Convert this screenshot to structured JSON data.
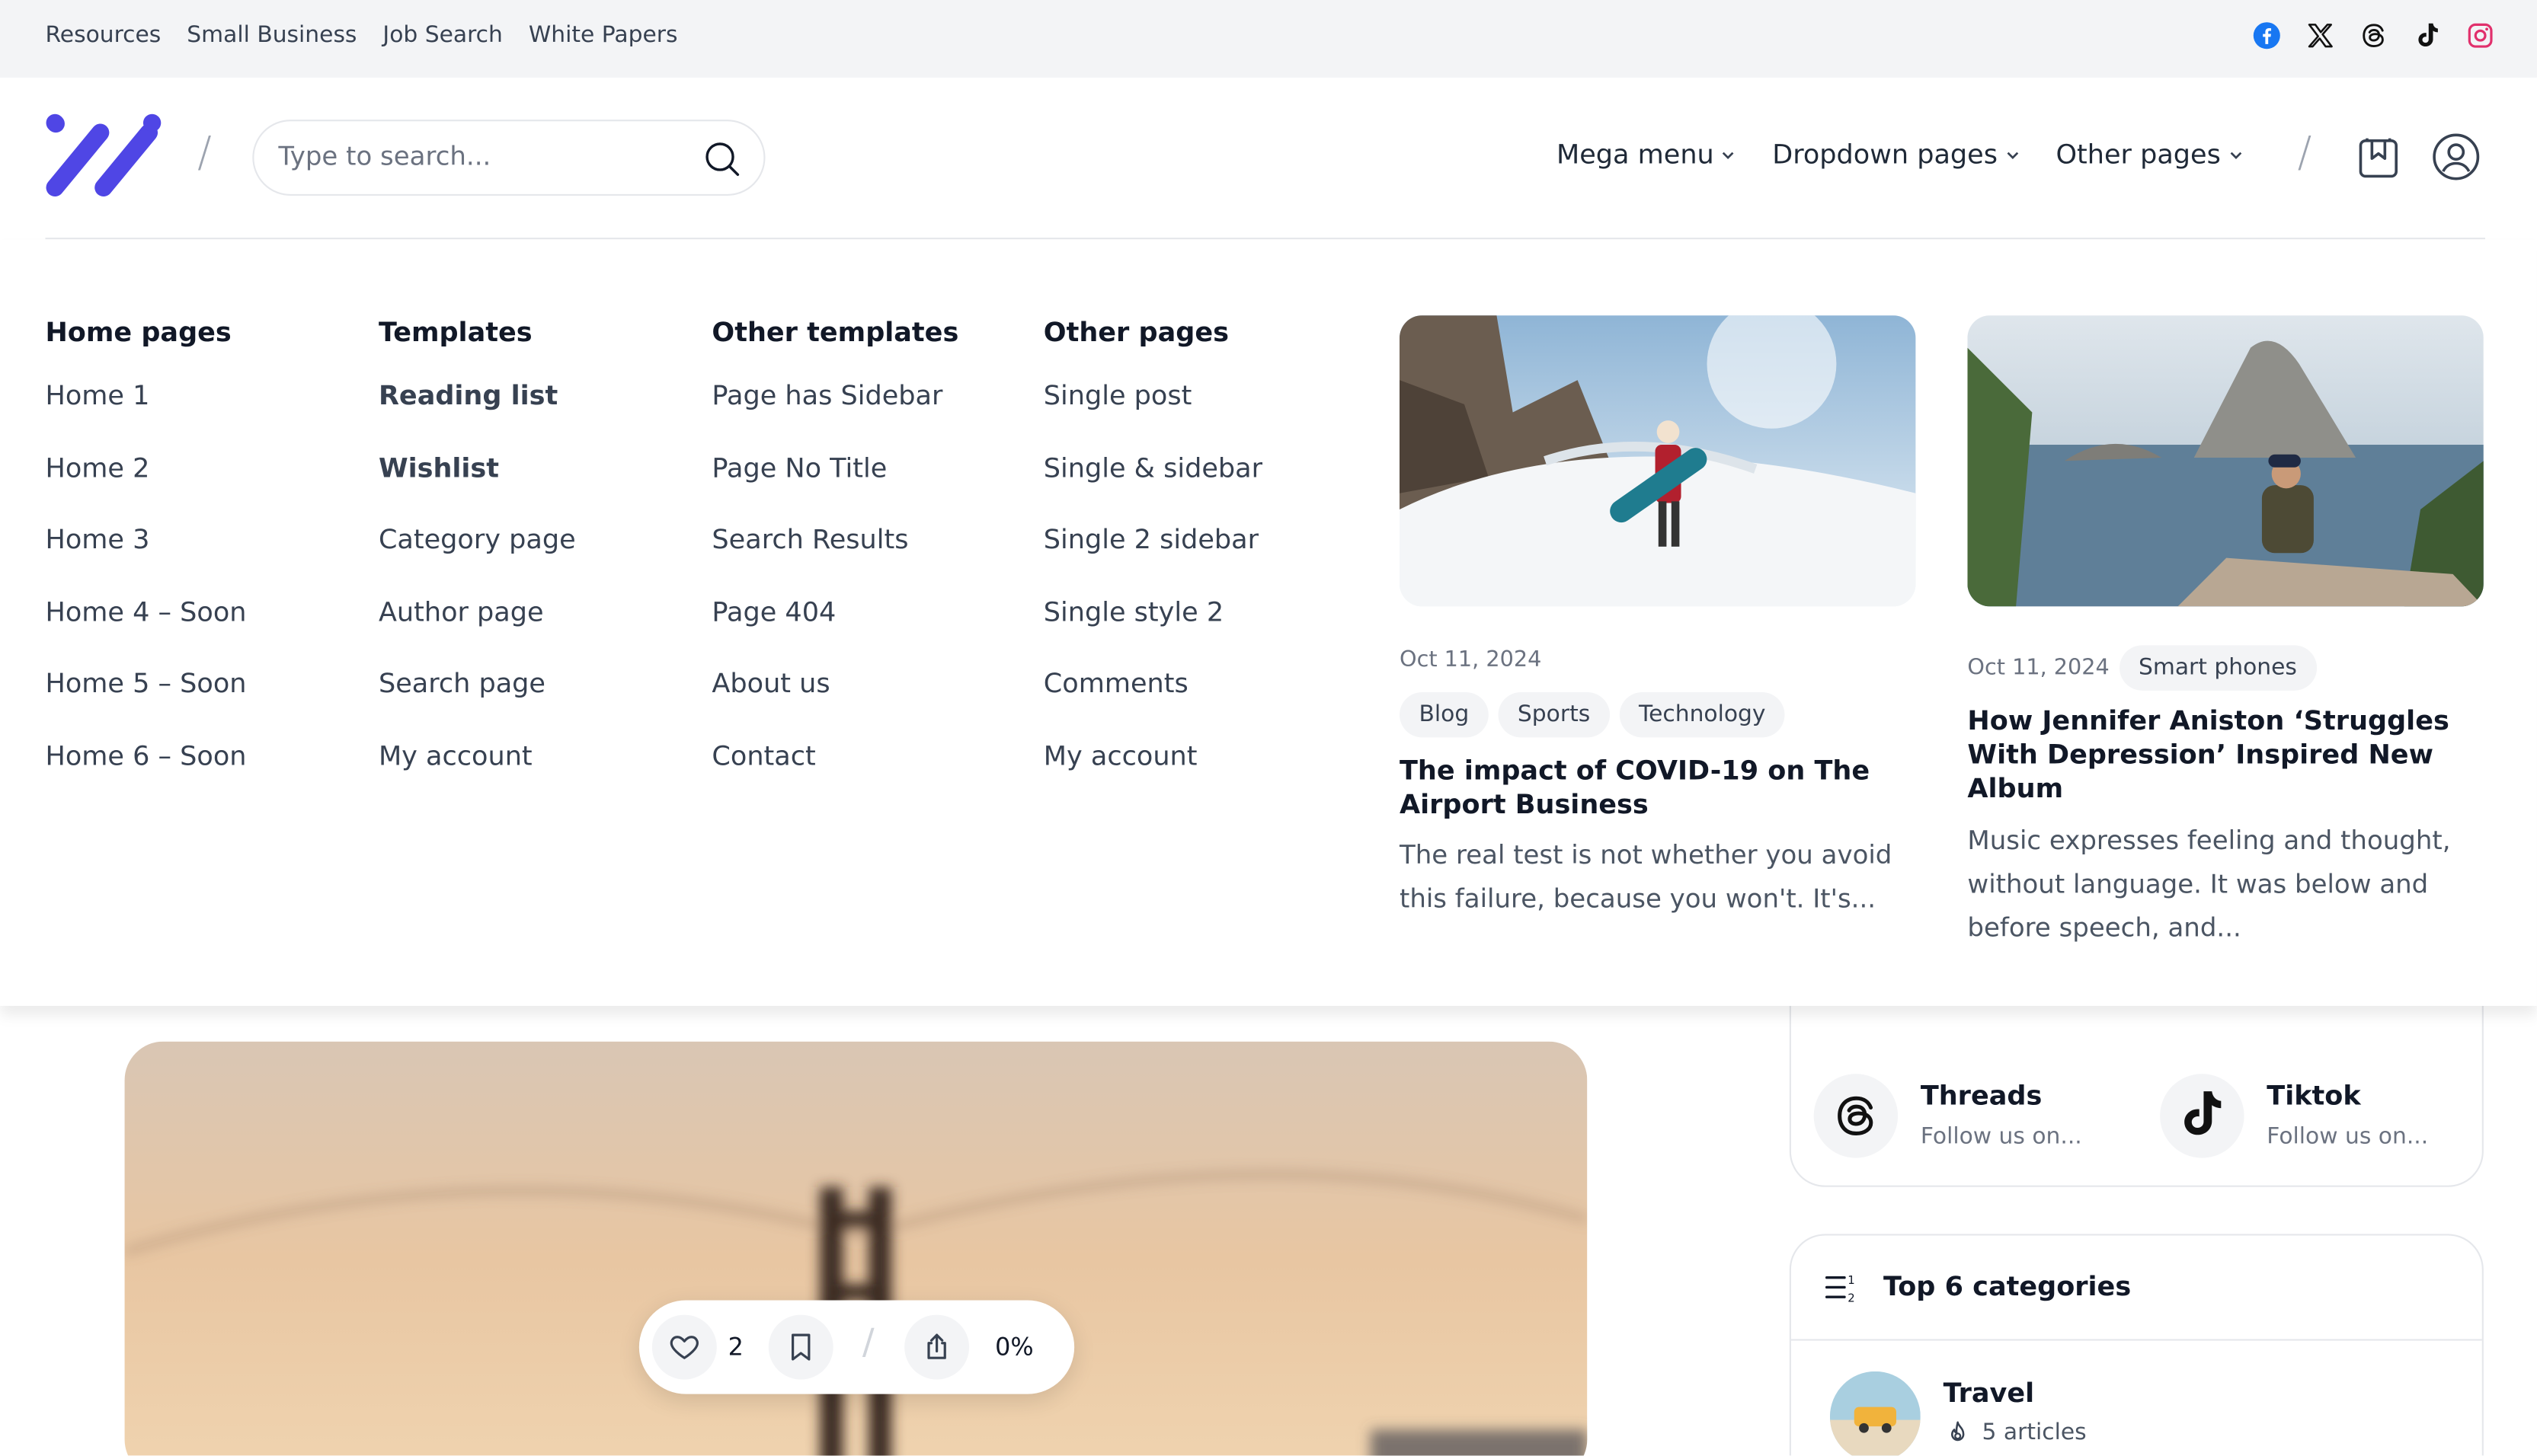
{
  "topbar": {
    "links": [
      "Resources",
      "Small Business",
      "Job Search",
      "White Papers"
    ],
    "social_icons": [
      "facebook-icon",
      "x-icon",
      "threads-icon",
      "tiktok-icon",
      "instagram-icon"
    ]
  },
  "colors": {
    "brand": "#4f46e5",
    "facebook": "#1877f2",
    "instagram": "#e1306c"
  },
  "header": {
    "search_placeholder": "Type to search...",
    "nav": [
      {
        "label": "Mega menu"
      },
      {
        "label": "Dropdown pages"
      },
      {
        "label": "Other pages"
      }
    ]
  },
  "mega_menu": {
    "columns": [
      {
        "title": "Home pages",
        "links": [
          "Home 1",
          "Home 2",
          "Home 3",
          "Home 4 – Soon",
          "Home 5 – Soon",
          "Home 6 – Soon"
        ]
      },
      {
        "title": "Templates",
        "links": [
          "Reading list",
          "Wishlist",
          "Category page",
          "Author page",
          "Search page",
          "My account"
        ]
      },
      {
        "title": "Other templates",
        "links": [
          "Page has Sidebar",
          "Page No Title",
          "Search Results",
          "Page 404",
          "About us",
          "Contact"
        ]
      },
      {
        "title": "Other pages",
        "links": [
          "Single post",
          "Single & sidebar",
          "Single 2 sidebar",
          "Single style 2",
          "Comments",
          "My account"
        ]
      }
    ],
    "posts": [
      {
        "date": "Oct 11, 2024",
        "tags": [
          "Blog",
          "Sports",
          "Technology"
        ],
        "title": "The impact of COVID-19 on The Airport Business",
        "excerpt": "The real test is not whether you avoid this failure, because you won't. It's..."
      },
      {
        "date": "Oct 11, 2024",
        "tags": [
          "Smart phones"
        ],
        "title": "How Jennifer Aniston ‘Struggles With Depression’ Inspired New Album",
        "excerpt": "Music expresses feeling and thought, without language. It was below and before speech, and..."
      }
    ]
  },
  "post_actions": {
    "likes": "2",
    "progress": "0%"
  },
  "sidebar": {
    "socials": [
      {
        "name": "Threads",
        "sub": "Follow us on..."
      },
      {
        "name": "Tiktok",
        "sub": "Follow us on..."
      }
    ],
    "categories": {
      "title": "Top 6 categories",
      "items": [
        {
          "name": "Travel",
          "count": "5 articles"
        }
      ]
    }
  }
}
